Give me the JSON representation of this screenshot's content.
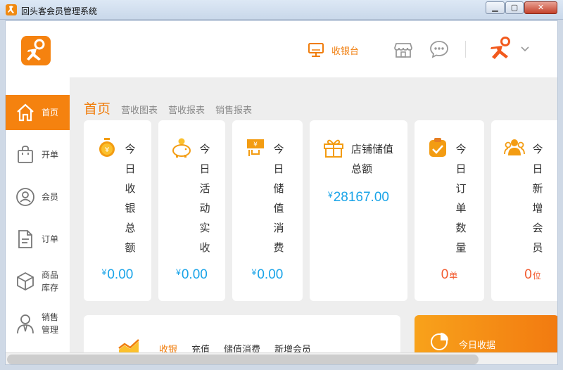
{
  "window": {
    "title": "回头客会员管理系统",
    "minimize": "▁",
    "maximize": "▢",
    "close": "✕"
  },
  "header": {
    "cashier_label": "收银台",
    "icons": [
      "monitor-icon",
      "store-icon",
      "chat-icon",
      "user-logo-icon",
      "chevron-down-icon"
    ]
  },
  "sidebar": {
    "items": [
      {
        "label": "首页",
        "icon": "home-icon",
        "active": true
      },
      {
        "label": "开单",
        "icon": "bag-icon"
      },
      {
        "label": "会员",
        "icon": "member-icon"
      },
      {
        "label": "订单",
        "icon": "document-icon"
      },
      {
        "label": "商品库存",
        "line1": "商品",
        "line2": "库存",
        "icon": "box-icon"
      },
      {
        "label": "销售管理",
        "line1": "销售",
        "line2": "管理",
        "icon": "salesperson-icon"
      }
    ]
  },
  "tabs": [
    {
      "label": "首页",
      "active": true
    },
    {
      "label": "营收图表"
    },
    {
      "label": "营收报表"
    },
    {
      "label": "销售报表"
    }
  ],
  "cards": [
    {
      "label": "今日收银总额",
      "currency": "¥",
      "value": "0.00",
      "icon": "coin-timer-icon"
    },
    {
      "label": "今日活动实收",
      "currency": "¥",
      "value": "0.00",
      "icon": "piggy-bank-icon"
    },
    {
      "label": "今日储值消费",
      "currency": "¥",
      "value": "0.00",
      "icon": "card-hand-icon"
    },
    {
      "label": "店铺储值总额",
      "currency": "¥",
      "value": "28167.00",
      "icon": "gift-icon"
    },
    {
      "label": "今日订单数量",
      "value": "0",
      "unit": "单",
      "icon": "clipboard-check-icon"
    },
    {
      "label": "今日新增会员",
      "value": "0",
      "unit": "位",
      "icon": "people-icon"
    }
  ],
  "bottom_tabs": [
    {
      "label": "收银",
      "active": true
    },
    {
      "label": "充值"
    },
    {
      "label": "储值消费"
    },
    {
      "label": "新增会员"
    }
  ],
  "today_panel": {
    "label": "今日收据"
  },
  "colors": {
    "accent": "#f5820f",
    "value_blue": "#1aa4e8",
    "value_orange": "#f25a2e"
  }
}
